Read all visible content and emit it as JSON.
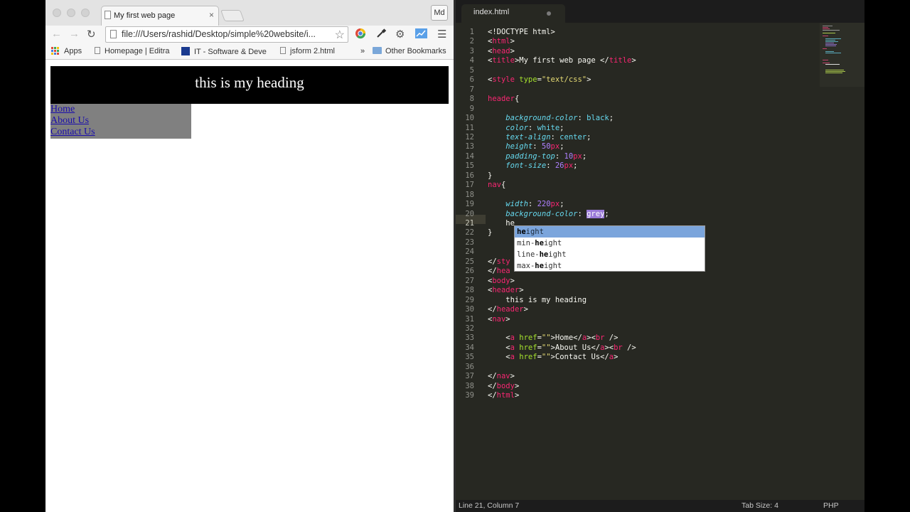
{
  "browser": {
    "tab_title": "My first web page",
    "tab_close": "×",
    "profile_label": "Md",
    "url": "file:///Users/rashid/Desktop/simple%20website/i...",
    "bookmarks": {
      "apps": "Apps",
      "items": [
        "Homepage | Editra",
        "IT - Software & Deve",
        "jsform 2.html"
      ],
      "overflow": "»",
      "other": "Other Bookmarks"
    },
    "page": {
      "heading": "this is my heading",
      "nav_links": [
        "Home",
        "About Us",
        "Contact Us"
      ]
    }
  },
  "editor": {
    "tab_name": "index.html",
    "code_lines": [
      [
        [
          "t",
          "<!DOCTYPE html>"
        ]
      ],
      [
        [
          "t",
          "<"
        ],
        [
          "r",
          "html"
        ],
        [
          "t",
          ">"
        ]
      ],
      [
        [
          "t",
          "<"
        ],
        [
          "r",
          "head"
        ],
        [
          "t",
          ">"
        ]
      ],
      [
        [
          "t",
          "<"
        ],
        [
          "r",
          "title"
        ],
        [
          "t",
          ">My first web page </"
        ],
        [
          "r",
          "title"
        ],
        [
          "t",
          ">"
        ]
      ],
      [],
      [
        [
          "t",
          "<"
        ],
        [
          "r",
          "style"
        ],
        [
          "t",
          " "
        ],
        [
          "g",
          "type"
        ],
        [
          "t",
          "="
        ],
        [
          "y",
          "\"text/css\""
        ],
        [
          "t",
          ">"
        ]
      ],
      [],
      [
        [
          "r",
          "header"
        ],
        [
          "t",
          "{"
        ]
      ],
      [],
      [
        [
          "t",
          "    "
        ],
        [
          "c",
          "background-color"
        ],
        [
          "t",
          ": "
        ],
        [
          "b",
          "black"
        ],
        [
          "t",
          ";"
        ]
      ],
      [
        [
          "t",
          "    "
        ],
        [
          "c",
          "color"
        ],
        [
          "t",
          ": "
        ],
        [
          "b",
          "white"
        ],
        [
          "t",
          ";"
        ]
      ],
      [
        [
          "t",
          "    "
        ],
        [
          "c",
          "text-align"
        ],
        [
          "t",
          ": "
        ],
        [
          "b",
          "center"
        ],
        [
          "t",
          ";"
        ]
      ],
      [
        [
          "t",
          "    "
        ],
        [
          "c",
          "height"
        ],
        [
          "t",
          ": "
        ],
        [
          "p",
          "50"
        ],
        [
          "r",
          "px"
        ],
        [
          "t",
          ";"
        ]
      ],
      [
        [
          "t",
          "    "
        ],
        [
          "c",
          "padding-top"
        ],
        [
          "t",
          ": "
        ],
        [
          "p",
          "10"
        ],
        [
          "r",
          "px"
        ],
        [
          "t",
          ";"
        ]
      ],
      [
        [
          "t",
          "    "
        ],
        [
          "c",
          "font-size"
        ],
        [
          "t",
          ": "
        ],
        [
          "p",
          "26"
        ],
        [
          "r",
          "px"
        ],
        [
          "t",
          ";"
        ]
      ],
      [
        [
          "t",
          "}"
        ]
      ],
      [
        [
          "r",
          "nav"
        ],
        [
          "t",
          "{"
        ]
      ],
      [],
      [
        [
          "t",
          "    "
        ],
        [
          "c",
          "width"
        ],
        [
          "t",
          ": "
        ],
        [
          "p",
          "220"
        ],
        [
          "r",
          "px"
        ],
        [
          "t",
          ";"
        ]
      ],
      [
        [
          "t",
          "    "
        ],
        [
          "c",
          "background-color"
        ],
        [
          "t",
          ": "
        ],
        [
          "h",
          "grey"
        ],
        [
          "t",
          ";"
        ]
      ],
      [
        [
          "t",
          "    he"
        ]
      ],
      [
        [
          "t",
          "}"
        ]
      ],
      [],
      [],
      [
        [
          "t",
          "</"
        ],
        [
          "r",
          "sty"
        ]
      ],
      [
        [
          "t",
          "</"
        ],
        [
          "r",
          "hea"
        ]
      ],
      [
        [
          "t",
          "<"
        ],
        [
          "r",
          "body"
        ],
        [
          "t",
          ">"
        ]
      ],
      [
        [
          "t",
          "<"
        ],
        [
          "r",
          "header"
        ],
        [
          "t",
          ">"
        ]
      ],
      [
        [
          "t",
          "    this is my heading"
        ]
      ],
      [
        [
          "t",
          "</"
        ],
        [
          "r",
          "header"
        ],
        [
          "t",
          ">"
        ]
      ],
      [
        [
          "t",
          "<"
        ],
        [
          "r",
          "nav"
        ],
        [
          "t",
          ">"
        ]
      ],
      [],
      [
        [
          "t",
          "    <"
        ],
        [
          "r",
          "a"
        ],
        [
          "t",
          " "
        ],
        [
          "g",
          "href"
        ],
        [
          "t",
          "="
        ],
        [
          "y",
          "\"\""
        ],
        [
          "t",
          ">Home</"
        ],
        [
          "r",
          "a"
        ],
        [
          "t",
          "><"
        ],
        [
          "r",
          "br"
        ],
        [
          "t",
          " />"
        ]
      ],
      [
        [
          "t",
          "    <"
        ],
        [
          "r",
          "a"
        ],
        [
          "t",
          " "
        ],
        [
          "g",
          "href"
        ],
        [
          "t",
          "="
        ],
        [
          "y",
          "\"\""
        ],
        [
          "t",
          ">About Us</"
        ],
        [
          "r",
          "a"
        ],
        [
          "t",
          "><"
        ],
        [
          "r",
          "br"
        ],
        [
          "t",
          " />"
        ]
      ],
      [
        [
          "t",
          "    <"
        ],
        [
          "r",
          "a"
        ],
        [
          "t",
          " "
        ],
        [
          "g",
          "href"
        ],
        [
          "t",
          "="
        ],
        [
          "y",
          "\"\""
        ],
        [
          "t",
          ">Contact Us</"
        ],
        [
          "r",
          "a"
        ],
        [
          "t",
          ">"
        ]
      ],
      [],
      [
        [
          "t",
          "</"
        ],
        [
          "r",
          "nav"
        ],
        [
          "t",
          ">"
        ]
      ],
      [
        [
          "t",
          "</"
        ],
        [
          "r",
          "body"
        ],
        [
          "t",
          ">"
        ]
      ],
      [
        [
          "t",
          "</"
        ],
        [
          "r",
          "html"
        ],
        [
          "t",
          ">"
        ]
      ]
    ],
    "active_line": 21,
    "autocomplete": {
      "typed": "he",
      "items": [
        {
          "before": "",
          "match": "he",
          "after": "ight"
        },
        {
          "before": "min-",
          "match": "he",
          "after": "ight"
        },
        {
          "before": "line-",
          "match": "he",
          "after": "ight"
        },
        {
          "before": "max-",
          "match": "he",
          "after": "ight"
        }
      ]
    },
    "status": {
      "position": "Line 21, Column 7",
      "tab_size": "Tab Size: 4",
      "syntax": "PHP"
    }
  },
  "colors": {
    "t": "#f8f8f2",
    "r": "#f92672",
    "g": "#a6e22e",
    "y": "#e6db74",
    "c": "#66d9ef",
    "b": "#66d9ef",
    "p": "#ae81ff",
    "h": "#f8f8f2"
  },
  "icons": [
    "back-arrow-icon",
    "forward-arrow-icon",
    "reload-icon",
    "star-icon",
    "chrome-extension-icon",
    "eyedropper-icon",
    "gear-icon",
    "chart-icon",
    "menu-icon"
  ]
}
